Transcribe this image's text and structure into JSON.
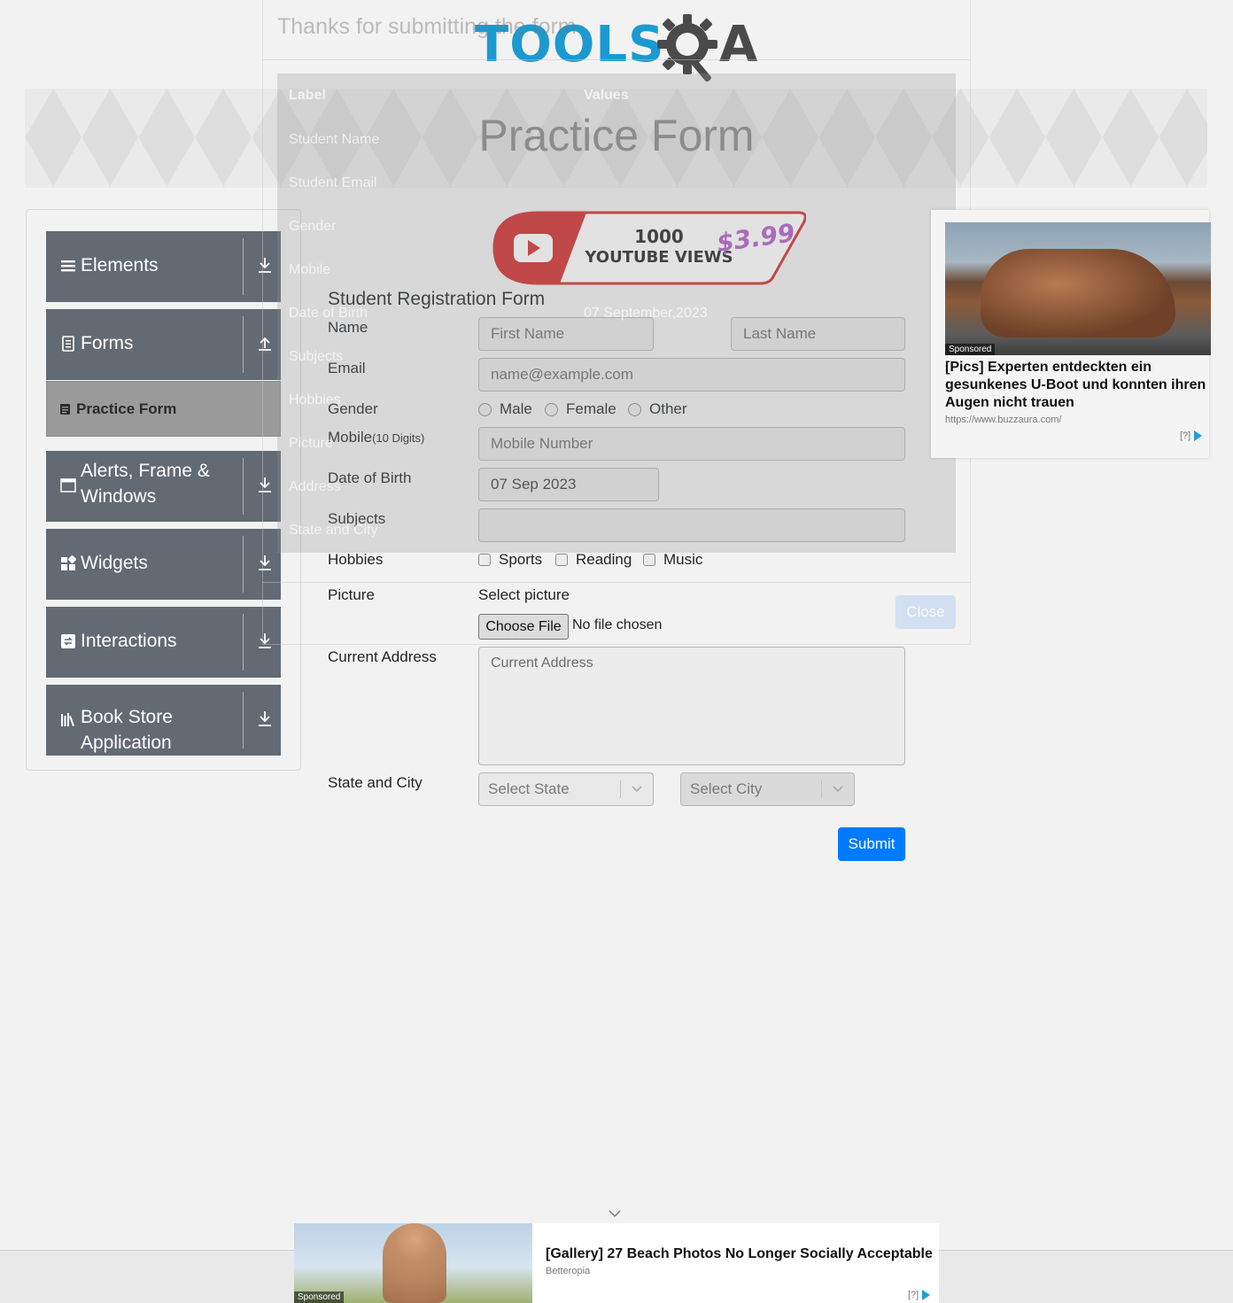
{
  "header": {
    "logo_text_tools": "TOOLS",
    "logo_text_a": "A",
    "banner_title": "Practice Form"
  },
  "sidebar": {
    "groups": [
      {
        "label": "Elements",
        "icon": "hamburger-icon",
        "arrow": "download-arrow-icon"
      },
      {
        "label": "Forms",
        "icon": "document-icon",
        "arrow": "upload-arrow-icon"
      },
      {
        "label": "Alerts, Frame & Windows",
        "icon": "window-icon",
        "arrow": "download-arrow-icon"
      },
      {
        "label": "Widgets",
        "icon": "widgets-icon",
        "arrow": "download-arrow-icon"
      },
      {
        "label": "Interactions",
        "icon": "interactions-icon",
        "arrow": "download-arrow-icon"
      },
      {
        "label": "Book Store Application",
        "icon": "books-icon",
        "arrow": "download-arrow-icon"
      }
    ],
    "active_item": "Practice Form"
  },
  "ad_top": {
    "line1": "1000",
    "line2": "YOUTUBE VIEWS",
    "price": "$3.99"
  },
  "form": {
    "title": "Student Registration Form",
    "name_label": "Name",
    "first_name_placeholder": "First Name",
    "last_name_placeholder": "Last Name",
    "email_label": "Email",
    "email_placeholder": "name@example.com",
    "gender_label": "Gender",
    "gender_options": [
      "Male",
      "Female",
      "Other"
    ],
    "mobile_label": "Mobile",
    "mobile_hint": "(10 Digits)",
    "mobile_placeholder": "Mobile Number",
    "dob_label": "Date of Birth",
    "dob_value": "07 Sep 2023",
    "subjects_label": "Subjects",
    "hobbies_label": "Hobbies",
    "hobby_options": [
      "Sports",
      "Reading",
      "Music"
    ],
    "picture_label": "Picture",
    "select_picture": "Select picture",
    "choose_file": "Choose File",
    "no_file": "No file chosen",
    "address_label": "Current Address",
    "address_placeholder": "Current Address",
    "state_city_label": "State and City",
    "state_placeholder": "Select State",
    "city_placeholder": "Select City",
    "submit": "Submit"
  },
  "modal": {
    "title": "Thanks for submitting the form",
    "col_label": "Label",
    "col_values": "Values",
    "rows": [
      {
        "label": "Student Name",
        "value": ""
      },
      {
        "label": "Student Email",
        "value": ""
      },
      {
        "label": "Gender",
        "value": ""
      },
      {
        "label": "Mobile",
        "value": ""
      },
      {
        "label": "Date of Birth",
        "value": "07 September,2023"
      },
      {
        "label": "Subjects",
        "value": ""
      },
      {
        "label": "Hobbies",
        "value": ""
      },
      {
        "label": "Picture",
        "value": ""
      },
      {
        "label": "Address",
        "value": ""
      },
      {
        "label": "State and City",
        "value": ""
      }
    ],
    "close": "Close"
  },
  "side_ad": {
    "sponsored": "Sponsored",
    "title": "[Pics] Experten entdeckten ein gesunkenes U-Boot und konnten ihren Augen nicht trauen",
    "url": "https://www.buzzaura.com/",
    "adchoice": "[?]"
  },
  "bottom_ad": {
    "sponsored": "Sponsored",
    "title": "[Gallery] 27 Beach Photos No Longer Socially Acceptable",
    "source": "Betteropia",
    "adchoice": "[?]"
  },
  "colors": {
    "logo_blue": "#1b9ad0",
    "sidebar_bg": "#626a73",
    "active_item_bg": "#9a9a9a",
    "submit_blue": "#007bff"
  }
}
